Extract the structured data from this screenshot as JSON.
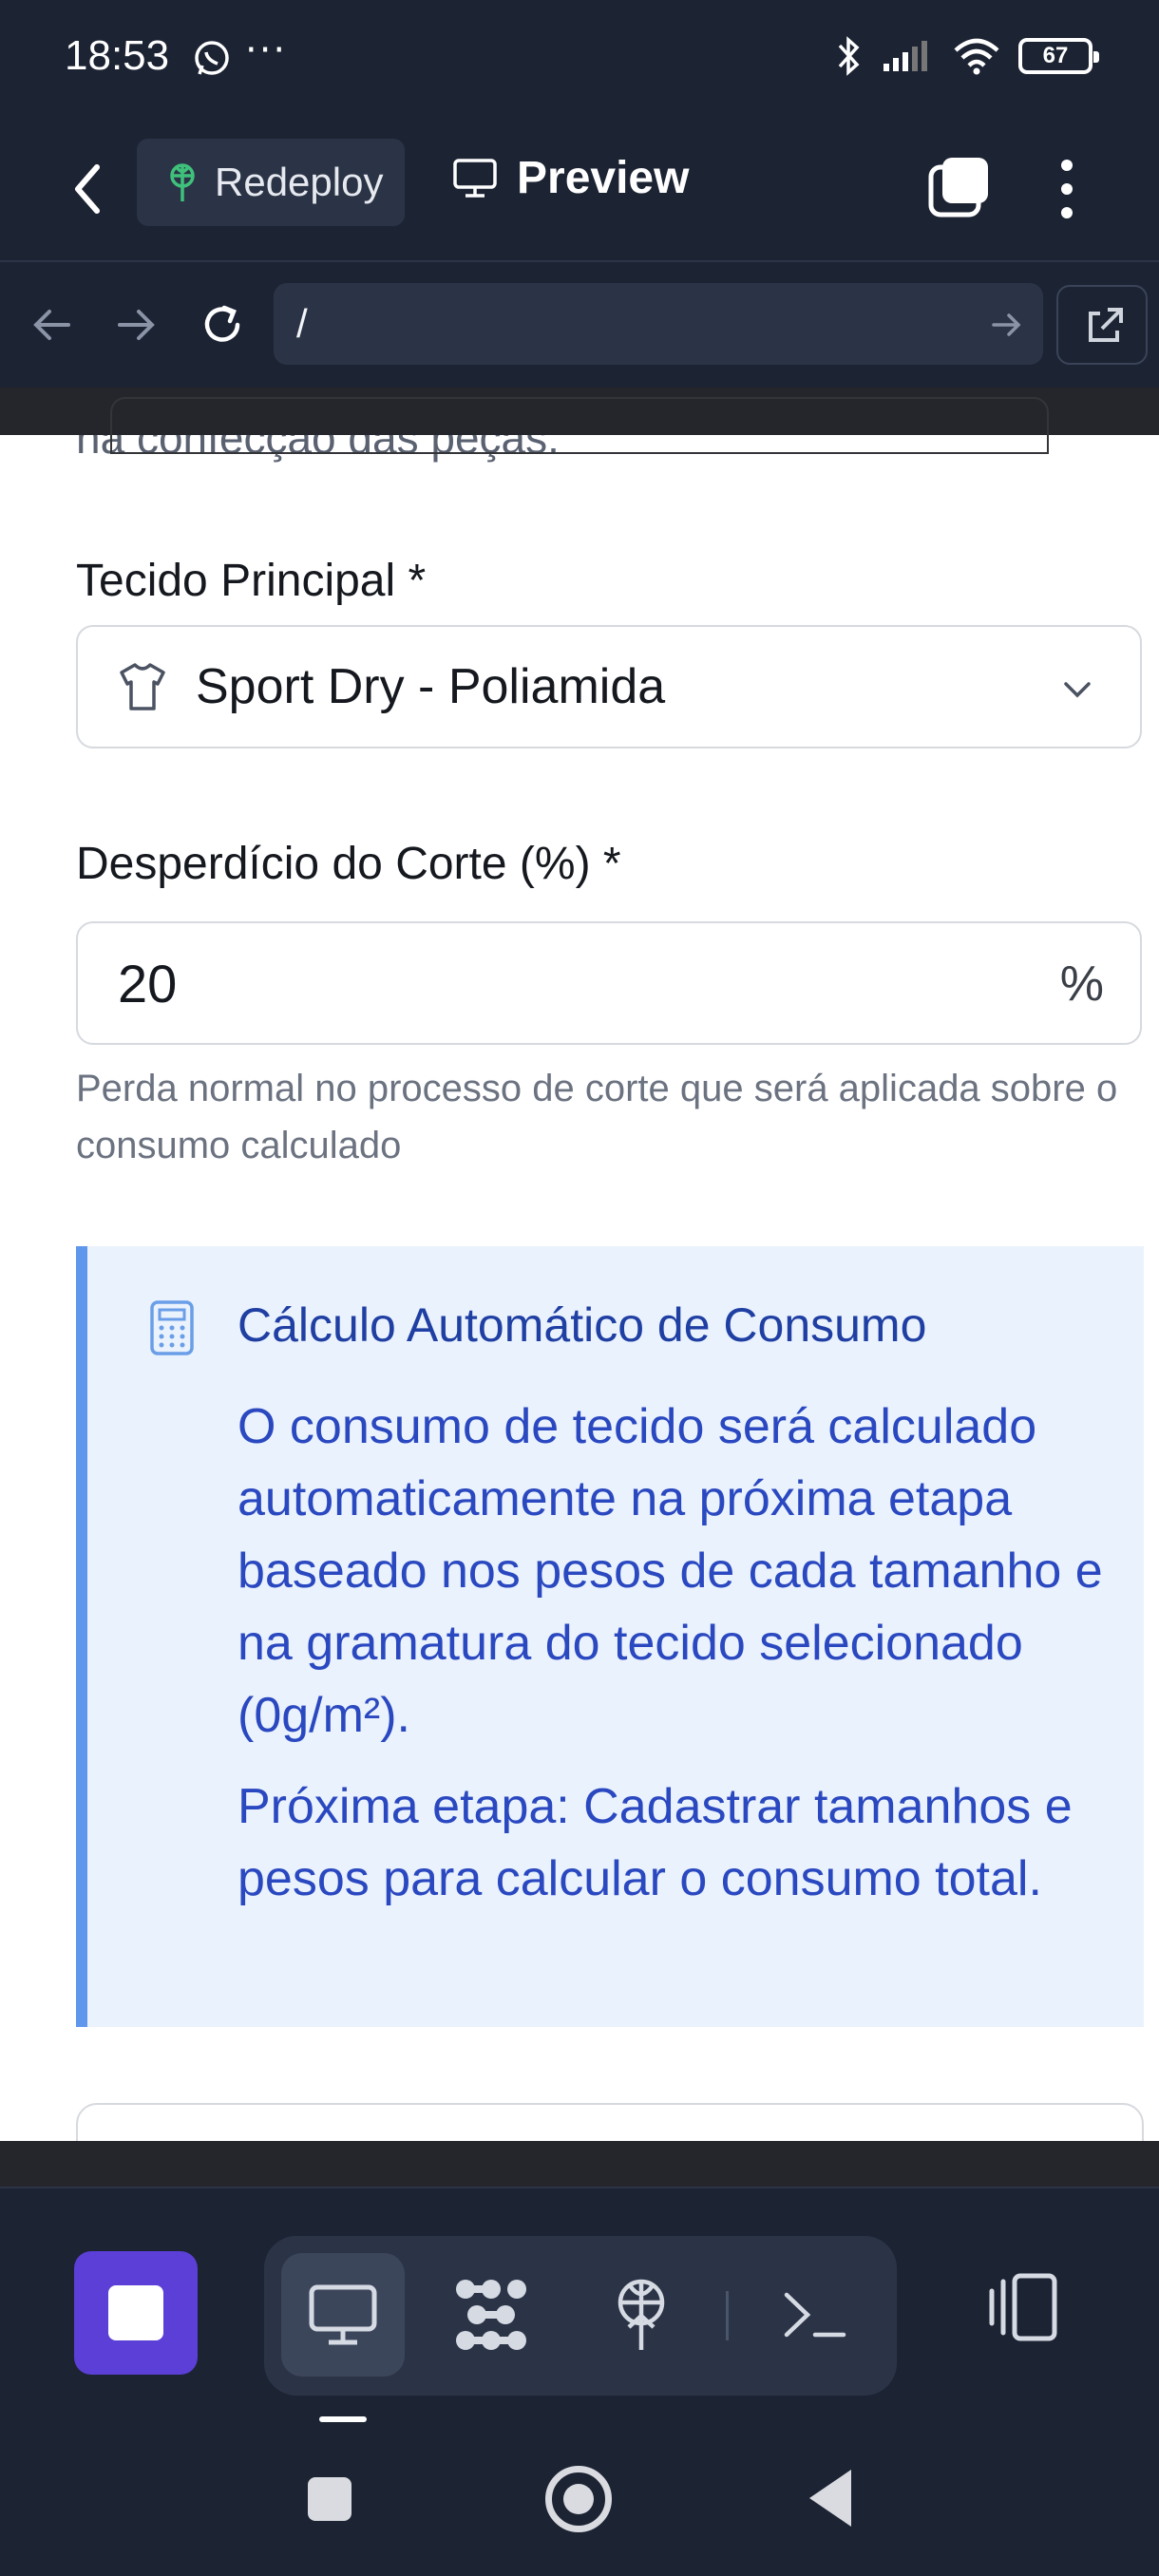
{
  "status_bar": {
    "time": "18:53",
    "more": "···",
    "battery": "67"
  },
  "header": {
    "redeploy_label": "Redeploy",
    "preview_label": "Preview"
  },
  "url_bar": {
    "url": "/"
  },
  "page": {
    "cut_text": "na confecção das peças.",
    "fabric": {
      "label": "Tecido Principal *",
      "value": "Sport Dry - Poliamida"
    },
    "waste": {
      "label": "Desperdício do Corte (%) *",
      "value": "20",
      "unit": "%",
      "help": "Perda normal no processo de corte que será aplicada sobre o consumo calculado"
    },
    "info": {
      "title": "Cálculo Automático de Consumo",
      "body": "O consumo de tecido será calculado automaticamente na próxima etapa baseado nos pesos de cada tamanho e na gramatura do tecido selecionado (0g/m²).",
      "next": "Próxima etapa: Cadastrar tamanhos e pesos para calcular o consumo total."
    }
  },
  "colors": {
    "accent": "#5b3fd6",
    "info_border": "#5f97ec",
    "info_bg": "#eaf2fd",
    "info_text": "#2a48c0"
  }
}
